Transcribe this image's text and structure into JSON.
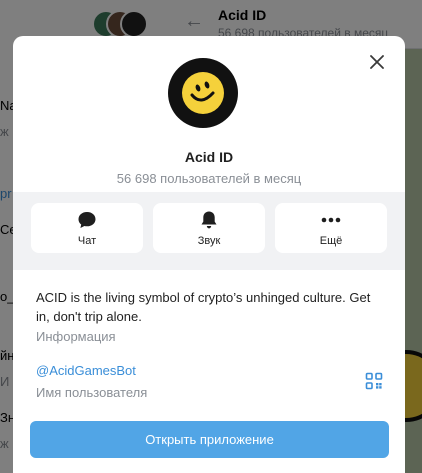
{
  "background": {
    "sidebar_fragments": [
      "Na",
      "ж",
      "pr",
      "C",
      "Ce",
      "o_",
      "йн",
      "И",
      "Зн",
      "ж"
    ],
    "chat_title": "Acid ID",
    "chat_subtitle": "56 698 пользователей в месяц"
  },
  "profile": {
    "name": "Acid ID",
    "subtitle": "56 698 пользователей в месяц"
  },
  "actions": {
    "chat_label": "Чат",
    "sound_label": "Звук",
    "more_label": "Ещё"
  },
  "info": {
    "description": "ACID is the living symbol of crypto’s unhinged culture. Get in, don't trip alone.",
    "description_caption": "Информация",
    "username": "@AcidGamesBot",
    "username_caption": "Имя пользователя"
  },
  "open_app_label": "Открыть приложение",
  "colors": {
    "accent": "#51a5e6",
    "link": "#3a8ed8",
    "avatar_yellow": "#f5d13b"
  }
}
